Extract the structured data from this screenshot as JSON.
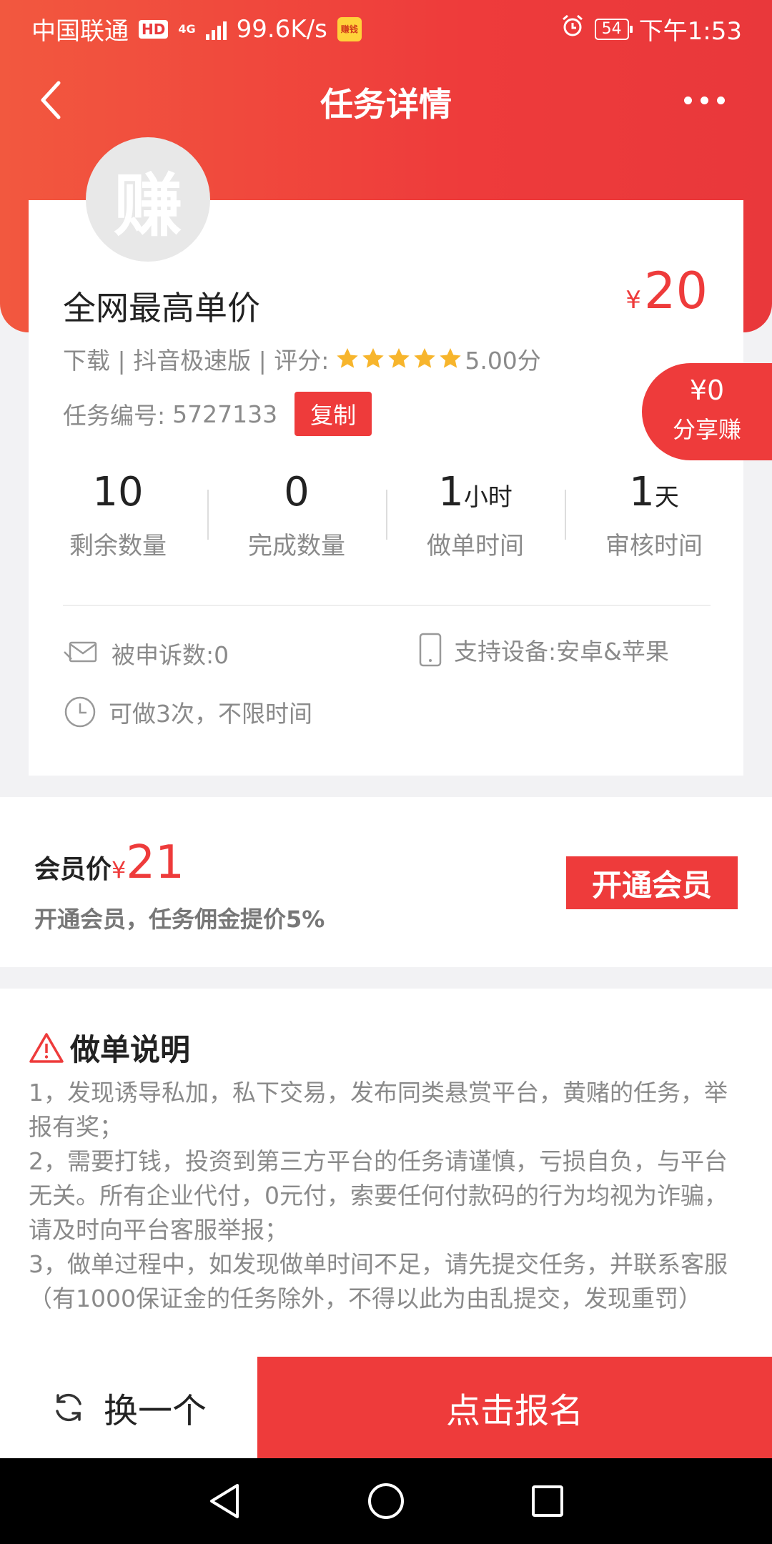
{
  "status_bar": {
    "carrier": "中国联通",
    "hd": "HD",
    "network": "4G",
    "speed": "99.6K/s",
    "app_badge": "赚钱",
    "battery": "54",
    "time": "下午1:53"
  },
  "header": {
    "title": "任务详情"
  },
  "task": {
    "avatar_char": "赚",
    "title": "全网最高单价",
    "price_symbol": "¥",
    "price": "20",
    "meta_prefix": "下载 | 抖音极速版 | 评分:",
    "rating": "5.00分",
    "stars": 5,
    "id_label": "任务编号:",
    "id": "5727133",
    "copy_label": "复制"
  },
  "share": {
    "amount": "¥0",
    "label": "分享赚"
  },
  "stats": [
    {
      "num": "10",
      "unit": "",
      "label": "剩余数量"
    },
    {
      "num": "0",
      "unit": "",
      "label": "完成数量"
    },
    {
      "num": "1",
      "unit": "小时",
      "label": "做单时间"
    },
    {
      "num": "1",
      "unit": "天",
      "label": "审核时间"
    }
  ],
  "info": {
    "complaints": "被申诉数:0",
    "devices": "支持设备:安卓&苹果",
    "limit": "可做3次，不限时间"
  },
  "member": {
    "label": "会员价",
    "symbol": "¥",
    "price": "21",
    "desc": "开通会员，任务佣金提价5%",
    "button": "开通会员"
  },
  "instructions": {
    "title": "做单说明",
    "lines": [
      "1，发现诱导私加，私下交易，发布同类悬赏平台，黄赌的任务，举报有奖；",
      "2，需要打钱，投资到第三方平台的任务请谨慎，亏损自负，与平台无关。所有企业代付，0元付，索要任何付款码的行为均视为诈骗，请及时向平台客服举报；",
      "3，做单过程中，如发现做单时间不足，请先提交任务，并联系客服（有1000保证金的任务除外，不得以此为由乱提交，发现重罚）"
    ]
  },
  "actions": {
    "switch": "换一个",
    "signup": "点击报名"
  },
  "colors": {
    "accent": "#ee3b3b",
    "header_start": "#f2583f"
  }
}
